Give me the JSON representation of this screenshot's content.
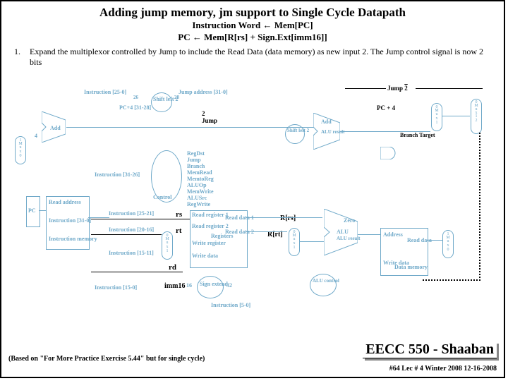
{
  "title": "Adding jump memory, jm support to Single Cycle Datapath",
  "instr1": "Instruction Word  ←  Mem[PC]",
  "instr2": "PC ← Mem[R[rs] + Sign.Ext[imm16]]",
  "bullet": {
    "num": "1.",
    "text": "Expand the multiplexor controlled by Jump to include the Read Data (data memory) as new input 2.   The Jump control signal is now 2 bits"
  },
  "labels": {
    "jump2a": "Jump",
    "jump2aval": "2",
    "jump2b": "2",
    "jumpb": "Jump",
    "pc4": "PC + 4",
    "branch": "Branch Target",
    "shl2": "Shift left 2",
    "jaddr": "Jump address [31-0]",
    "instr250": "Instruction [25-0]",
    "pc43128": "PC+4 [31-28]",
    "add1": "Add",
    "four": "4",
    "add2": "Add",
    "aluresult": "ALU result",
    "shl2b": "Shift left 2",
    "regdst": "RegDst",
    "jumpc": "Jump",
    "branchc": "Branch",
    "memread": "MemRead",
    "memtoreg": "MemtoReg",
    "aluop": "ALUOp",
    "memwrite": "MemWrite",
    "alusrc": "ALUSrc",
    "regwrite": "RegWrite",
    "control": "Control",
    "instr3126": "Instruction [31-26]",
    "rs": "rs",
    "rt": "rt",
    "rd": "rd",
    "instr2521": "Instruction [25-21]",
    "instr2016": "Instruction [20-16]",
    "instr1511": "Instruction [15-11]",
    "instr150": "Instruction [15-0]",
    "readaddr": "Read address",
    "instrmem": "Instruction memory",
    "instrout": "Instruction [31-0]",
    "pc": "PC",
    "readreg1": "Read register 1",
    "readreg2": "Read register 2",
    "writereg": "Write register",
    "writedata": "Write data",
    "registers": "Registers",
    "readdata1": "Read data 1",
    "readdata2": "Read data 2",
    "rrs": "R[rs]",
    "rrt": "R[rt]",
    "signext": "Sign extend",
    "n16": "16",
    "n32": "32",
    "imm16": "imm16",
    "zero": "Zero",
    "alu": "ALU",
    "aluresult2": "ALU result",
    "address": "Address",
    "writedata2": "Write data",
    "datamem": "Data memory",
    "readdata": "Read data",
    "alucontrol": "ALU control",
    "instr50": "Instruction [5-0]",
    "mux0": "0",
    "mux1": "1",
    "mux2": "2",
    "muxlabel": "M\nu\nx"
  },
  "footer": {
    "left": "(Based on \"For More Practice Exercise 5.44\" but for single cycle)",
    "right": "EECC 550 - Shaaban",
    "sub": "#64  Lec # 4   Winter 2008  12-16-2008"
  }
}
